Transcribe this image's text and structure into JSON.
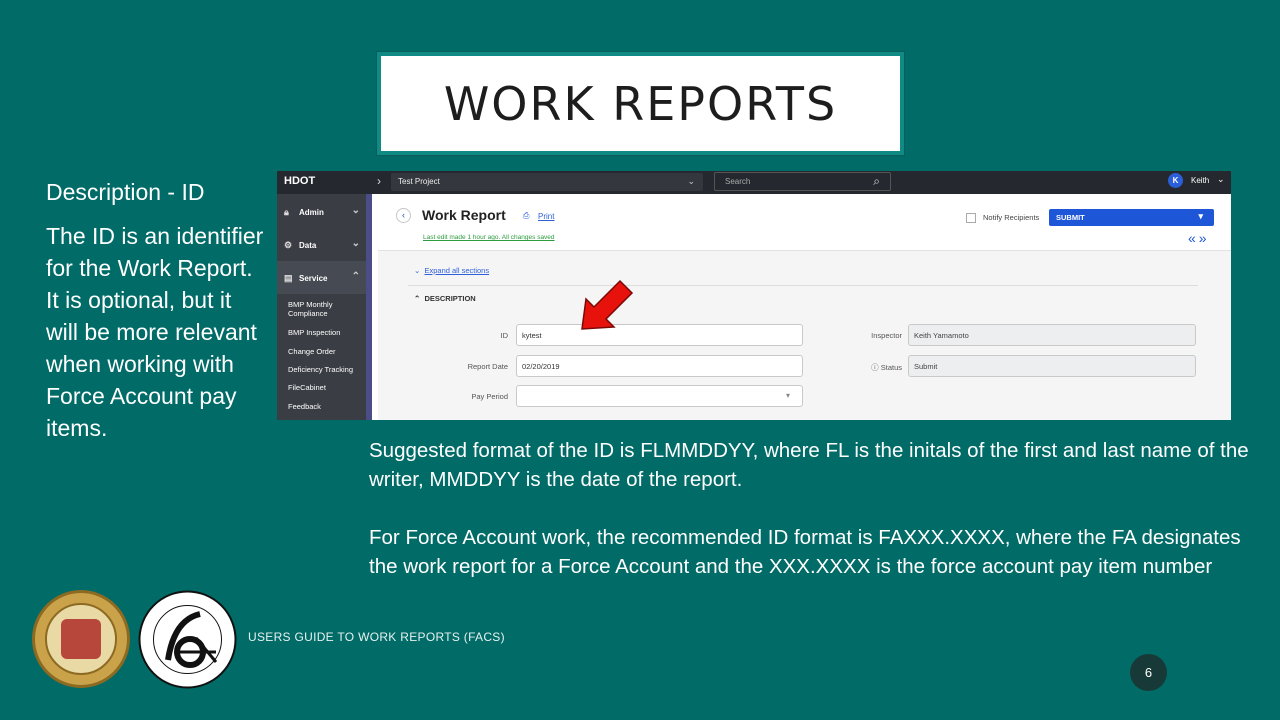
{
  "slide": {
    "title": "WORK REPORTS",
    "left_heading": "Description - ID",
    "left_body": "The ID is an identifier for the Work Report.  It is optional, but it will be more relevant when working with Force Account pay items.",
    "paragraph_1": "Suggested format of the ID is FLMMDDYY, where FL is the initals of the first and last name of the writer, MMDDYY is the date of the report.",
    "paragraph_2": "For Force Account work, the recommended ID format is FAXXX.XXXX, where the FA designates the work report for a Force Account and the XXX.XXXX is the force account pay item number",
    "footer": "USERS GUIDE TO WORK REPORTS  (FACS)",
    "page_number": "6"
  },
  "app": {
    "brand": "HDOT",
    "project": "Test Project",
    "search_placeholder": "Search",
    "user_initial": "K",
    "user_name": "Keith",
    "sidebar": {
      "sections": [
        {
          "label": "Admin",
          "icon": "lock-icon"
        },
        {
          "label": "Data",
          "icon": "gears-icon"
        },
        {
          "label": "Service",
          "icon": "documents-icon"
        }
      ],
      "items": [
        "BMP Monthly Compliance",
        "BMP Inspection",
        "Change Order",
        "Deficiency Tracking",
        "FileCabinet",
        "Feedback"
      ]
    },
    "header": {
      "title": "Work Report",
      "print_label": "Print",
      "last_edit": "Last edit made 1 hour ago. All changes saved",
      "notify_label": "Notify Recipients",
      "submit_label": "SUBMIT"
    },
    "expand_label": "Expand all sections",
    "section_title": "DESCRIPTION",
    "fields": {
      "id_label": "ID",
      "id_value": "kytest",
      "report_date_label": "Report Date",
      "report_date_value": "02/20/2019",
      "pay_period_label": "Pay Period",
      "pay_period_value": "",
      "inspector_label": "Inspector",
      "inspector_value": "Keith Yamamoto",
      "status_label": "Status",
      "status_value": "Submit"
    }
  },
  "colors": {
    "background": "#016b67",
    "accent_blue": "#1d56d6",
    "arrow_red": "#e8120c"
  }
}
